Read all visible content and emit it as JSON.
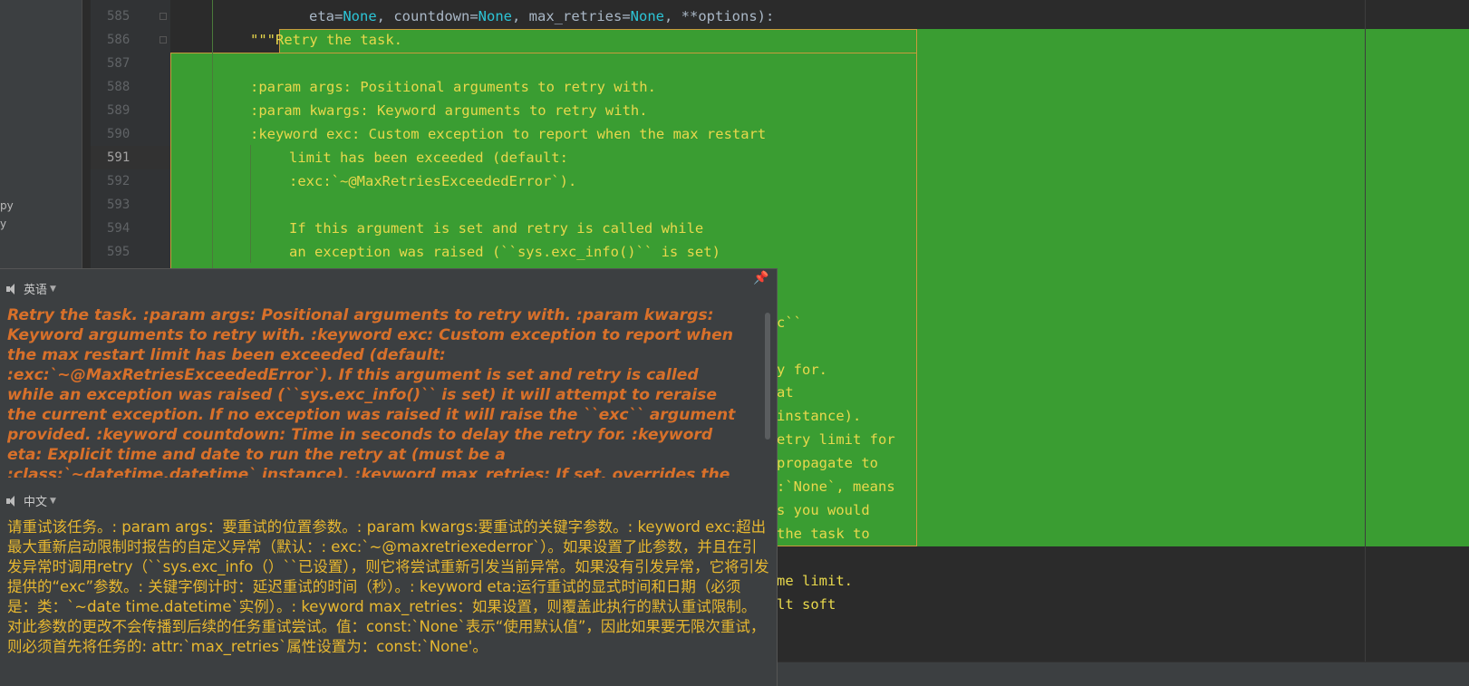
{
  "sidebar": {
    "items": [
      "py",
      "y"
    ]
  },
  "gutter": {
    "line_numbers": [
      "585",
      "586",
      "587",
      "588",
      "589",
      "590",
      "591",
      "592",
      "593",
      "594",
      "595"
    ],
    "current_line": "591"
  },
  "code": {
    "line_585": {
      "p1": "eta",
      "p2": "=",
      "p3": "None",
      "p4": ", countdown",
      "p5": "=",
      "p6": "None",
      "p7": ", max_retries",
      "p8": "=",
      "p9": "None",
      "p10": ", **",
      "p11": "options):"
    },
    "line_586": {
      "quote": "\"\"\"",
      "text": "Retry the task."
    },
    "line_588": ":param args: Positional arguments to retry with.",
    "line_589": ":param kwargs: Keyword arguments to retry with.",
    "line_590": ":keyword exc: Custom exception to report when the max restart",
    "line_591": "limit has been exceeded (default:",
    "line_592": ":exc:`~@MaxRetriesExceededError`).",
    "line_594": "If this argument is set and retry is called while",
    "line_595": "an exception was raised (``sys.exc_info()`` is set)",
    "hidden_fragments": [
      "c``",
      "y for.",
      "at",
      "instance).",
      "etry limit for",
      "propagate to",
      ":`None`, means",
      "s you would",
      "the task to",
      "me limit.",
      "lt soft"
    ]
  },
  "popup": {
    "source_lang": "英语",
    "target_lang": "中文",
    "source_text": "Retry the task. :param args: Positional arguments to retry with. :param kwargs: Keyword arguments to retry with. :keyword exc: Custom exception to report when the max restart limit has been exceeded (default: :exc:`~@MaxRetriesExceededError`). If this argument is set and retry is called while an exception was raised (``sys.exc_info()`` is set) it will attempt to reraise the current exception. If no exception was raised it will raise the ``exc`` argument provided. :keyword countdown: Time in seconds to delay the retry for. :keyword eta: Explicit time and date to run the retry at (must be a :class:`~datetime.datetime` instance). :keyword max_retries: If set, overrides the default retry limit for this execution. Changes to this",
    "translated_text": "请重试该任务。: param args：要重试的位置参数。: param kwargs:要重试的关键字参数。: keyword exc:超出最大重新启动限制时报告的自定义异常（默认：: exc:`~@maxretriexederror`）。如果设置了此参数，并且在引发异常时调用retry（``sys.exc_info（）``已设置），则它将尝试重新引发当前异常。如果没有引发异常，它将引发提供的“exc”参数。: 关键字倒计时：延迟重试的时间（秒）。: keyword eta:运行重试的显式时间和日期（必须是：类：`~date time.datetime`实例）。: keyword max_retries：如果设置，则覆盖此执行的默认重试限制。对此参数的更改不会传播到后续的任务重试尝试。值：const:`None`表示“使用默认值”，因此如果要无限次重试，则必须首先将任务的: attr:`max_retries`属性设置为：const:`None'。"
  }
}
